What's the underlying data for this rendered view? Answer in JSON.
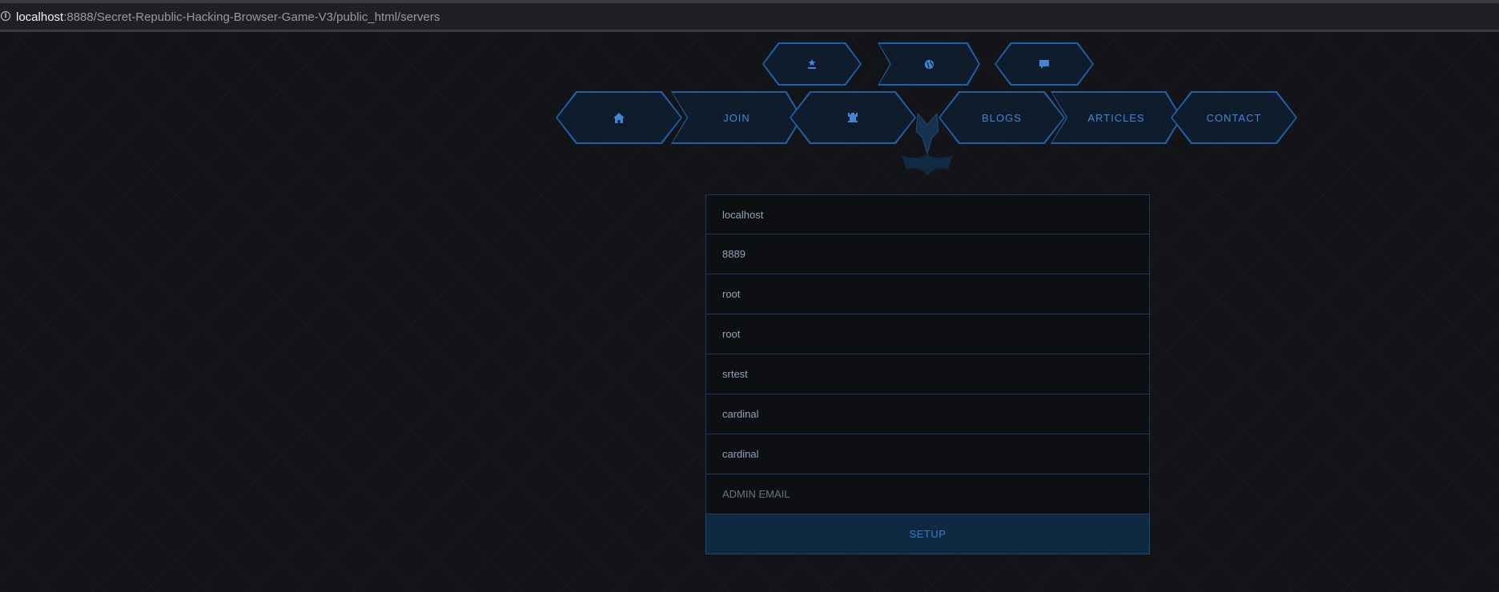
{
  "browser": {
    "url_host": "localhost",
    "url_rest": ":8888/Secret-Republic-Hacking-Browser-Game-V3/public_html/servers"
  },
  "nav": {
    "top_icons": [
      "rank-icon",
      "globe-icon",
      "chat-icon"
    ],
    "items": [
      {
        "icon": "home-icon",
        "label": ""
      },
      {
        "label": "JOIN"
      },
      {
        "icon": "castle-icon",
        "label": ""
      },
      {
        "label": "BLOGS"
      },
      {
        "label": "ARTICLES"
      },
      {
        "label": "CONTACT"
      }
    ]
  },
  "form": {
    "fields": [
      {
        "name": "host",
        "value": "localhost",
        "placeholder": ""
      },
      {
        "name": "port",
        "value": "8889",
        "placeholder": ""
      },
      {
        "name": "user",
        "value": "root",
        "placeholder": ""
      },
      {
        "name": "password",
        "value": "root",
        "placeholder": ""
      },
      {
        "name": "database",
        "value": "srtest",
        "placeholder": ""
      },
      {
        "name": "admin-username",
        "value": "cardinal",
        "placeholder": ""
      },
      {
        "name": "admin-password",
        "value": "cardinal",
        "placeholder": ""
      },
      {
        "name": "admin-email",
        "value": "",
        "placeholder": "ADMIN EMAIL"
      }
    ],
    "submit_label": "SETUP"
  },
  "colors": {
    "accent": "#2f7fd1",
    "border": "#1d3a63",
    "background": "#131417"
  }
}
